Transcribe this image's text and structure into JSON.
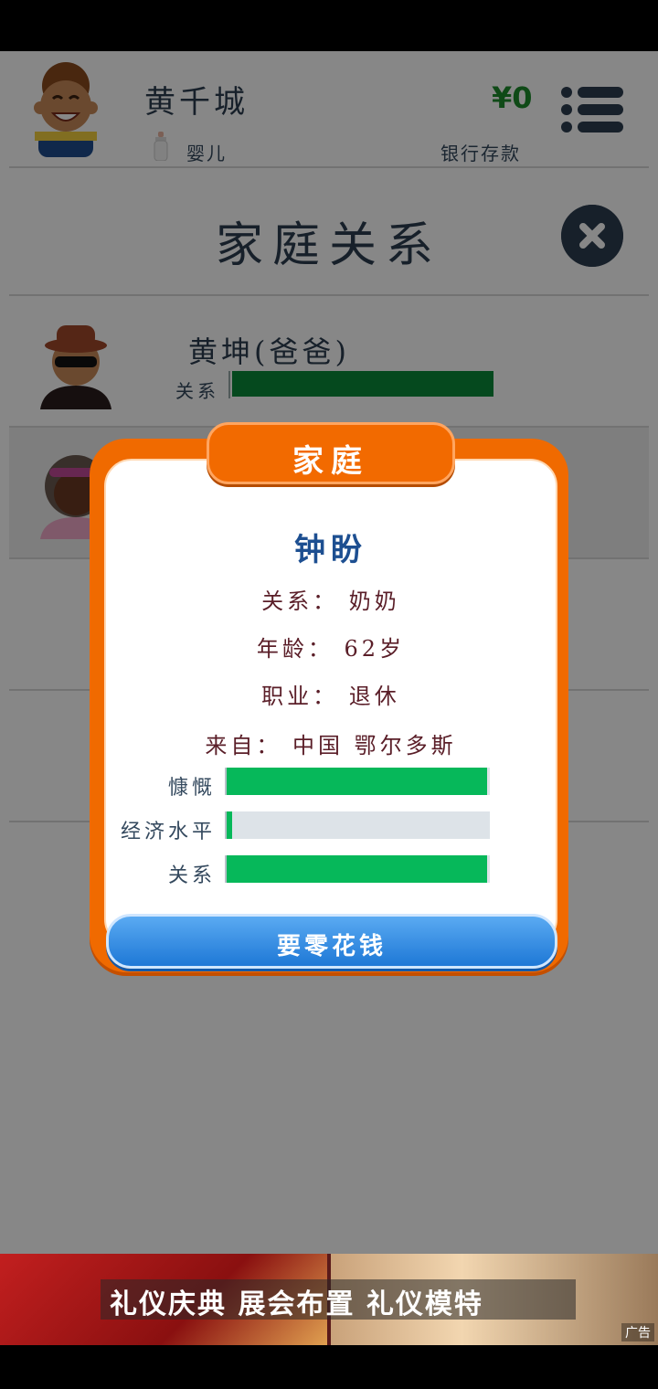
{
  "player": {
    "name": "黄千城",
    "stage": "婴儿",
    "money": "¥0",
    "money_label": "银行存款"
  },
  "page_title": "家庭关系",
  "family": [
    {
      "name": "黄坤(爸爸)",
      "relation_label": "关系",
      "relation_level": 1.0
    }
  ],
  "popup": {
    "tab": "家庭",
    "name": "钟盼",
    "relation": "关系：  奶奶",
    "age": "年龄：  62岁",
    "job": "职业：  退休",
    "origin": "来自：  中国 鄂尔多斯",
    "bars": [
      {
        "label": "慷慨",
        "level": 0.99
      },
      {
        "label": "经济水平",
        "level": 0.02
      },
      {
        "label": "关系",
        "level": 0.99
      }
    ],
    "button": "要零花钱"
  },
  "ad": {
    "text": "礼仪庆典  展会布置  礼仪模特",
    "tag": "广告"
  },
  "colors": {
    "bar_fill": "#06b85a",
    "popup_orange": "#f06a00",
    "money_green": "#1e8c2d"
  }
}
